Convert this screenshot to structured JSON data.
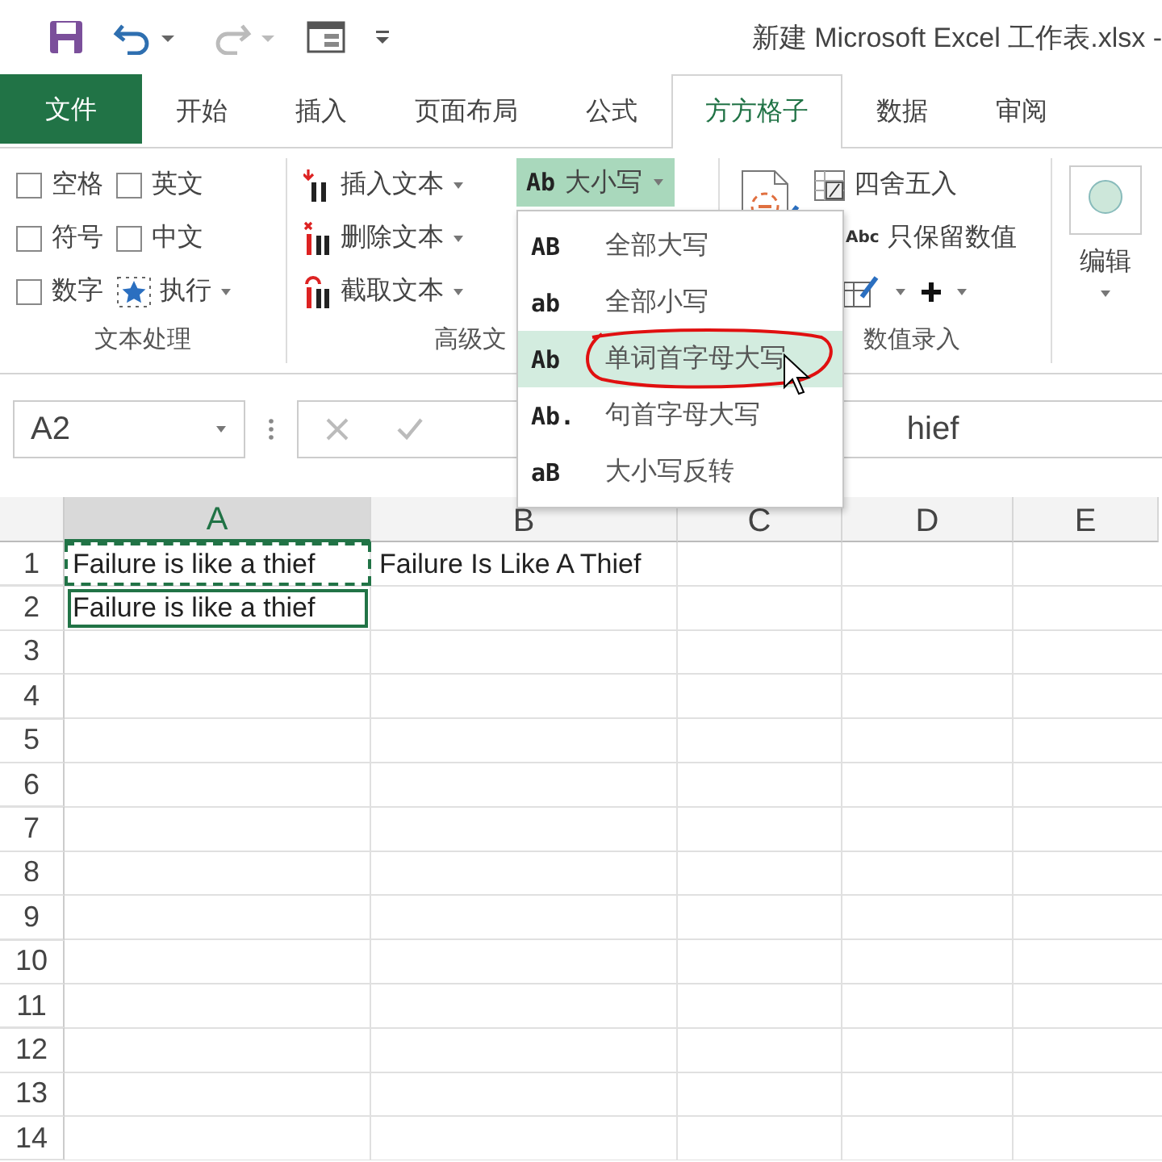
{
  "window": {
    "title": "新建 Microsoft Excel 工作表.xlsx -"
  },
  "tabs": [
    {
      "label": "文件",
      "kind": "file",
      "selected": false
    },
    {
      "label": "开始",
      "kind": "tab",
      "selected": false
    },
    {
      "label": "插入",
      "kind": "tab",
      "selected": false
    },
    {
      "label": "页面布局",
      "kind": "tab",
      "selected": false
    },
    {
      "label": "公式",
      "kind": "tab",
      "selected": false
    },
    {
      "label": "方方格子",
      "kind": "tab",
      "selected": true
    },
    {
      "label": "数据",
      "kind": "tab",
      "selected": false
    },
    {
      "label": "审阅",
      "kind": "tab",
      "selected": false
    }
  ],
  "ribbon": {
    "text_group": {
      "label": "文本处理",
      "checkboxes": [
        {
          "label": "空格",
          "checked": false
        },
        {
          "label": "英文",
          "checked": false
        },
        {
          "label": "符号",
          "checked": false
        },
        {
          "label": "中文",
          "checked": false
        },
        {
          "label": "数字",
          "checked": false
        }
      ],
      "run_button": "执行"
    },
    "advanced_group": {
      "label": "高级文",
      "buttons": [
        {
          "label": "插入文本",
          "kind": "insert"
        },
        {
          "label": "删除文本",
          "kind": "delete"
        },
        {
          "label": "截取文本",
          "kind": "extract"
        }
      ]
    },
    "case_button": {
      "icon_text": "Ab",
      "label": "大小写",
      "expanded": true
    },
    "number_group": {
      "label": "数值录入",
      "buttons": [
        {
          "label": "四舍五入"
        },
        {
          "label": "只保留数值",
          "icon_text": "Abc"
        }
      ]
    },
    "edit_button": "编辑"
  },
  "case_menu": [
    {
      "icon_text": "AB",
      "label": "全部大写",
      "selected": false
    },
    {
      "icon_text": "ab",
      "label": "全部小写",
      "selected": false
    },
    {
      "icon_text": "Ab",
      "label": "单词首字母大写",
      "selected": true
    },
    {
      "icon_text": "Ab.",
      "label": "句首字母大写",
      "selected": false
    },
    {
      "icon_text": "aB",
      "label": "大小写反转",
      "selected": false
    }
  ],
  "formula_bar": {
    "name_box": "A2",
    "value": "hief"
  },
  "sheet": {
    "columns": [
      "A",
      "B",
      "C",
      "D",
      "E"
    ],
    "rows": [
      {
        "number": "1",
        "cells": [
          {
            "text": "Failure is like a thief",
            "selected": false,
            "copied": true
          },
          {
            "text": "Failure Is Like A Thief",
            "selected": false,
            "copied": false
          }
        ]
      },
      {
        "number": "2",
        "cells": [
          {
            "text": "Failure is like a thief",
            "selected": true,
            "copied": false
          }
        ]
      },
      {
        "number": "3",
        "cells": []
      },
      {
        "number": "4",
        "cells": []
      },
      {
        "number": "5",
        "cells": []
      },
      {
        "number": "6",
        "cells": []
      },
      {
        "number": "7",
        "cells": []
      },
      {
        "number": "8",
        "cells": []
      },
      {
        "number": "9",
        "cells": []
      },
      {
        "number": "10",
        "cells": []
      },
      {
        "number": "11",
        "cells": []
      },
      {
        "number": "12",
        "cells": []
      },
      {
        "number": "13",
        "cells": []
      },
      {
        "number": "14",
        "cells": []
      }
    ]
  }
}
